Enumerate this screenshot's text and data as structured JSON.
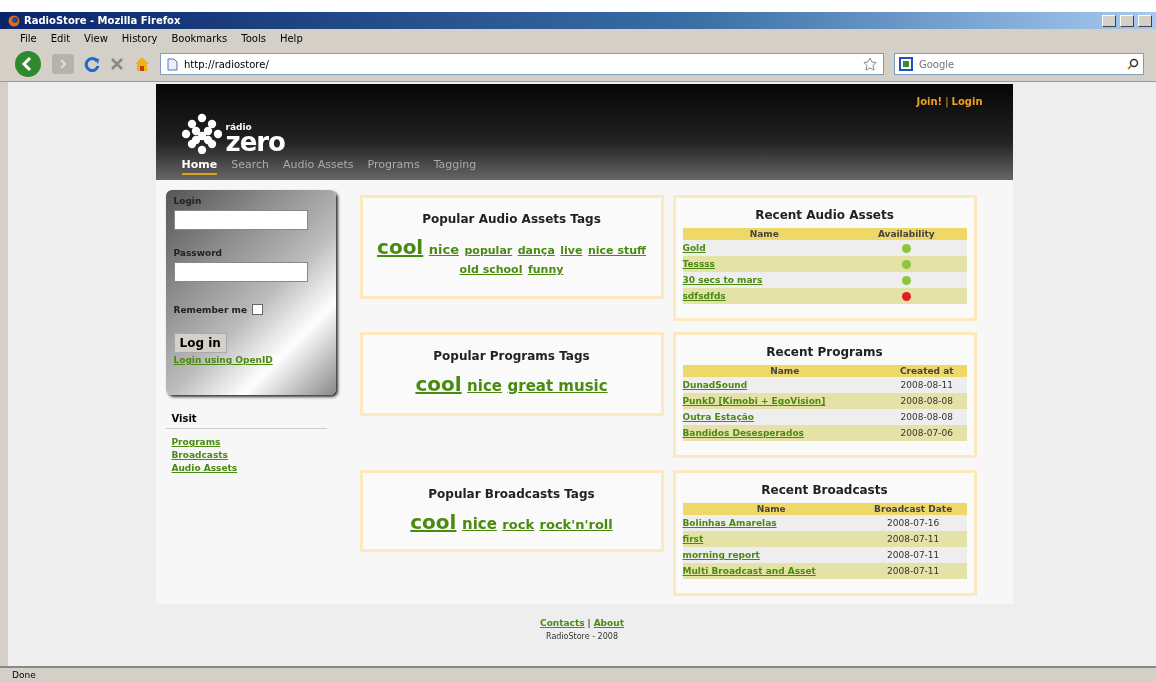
{
  "window": {
    "title": "RadioStore - Mozilla Firefox"
  },
  "menu": [
    "File",
    "Edit",
    "View",
    "History",
    "Bookmarks",
    "Tools",
    "Help"
  ],
  "address": {
    "value": "http://radiostore/"
  },
  "search": {
    "placeholder": "Google"
  },
  "site": {
    "logo_small": "rádio",
    "logo_big": "zero",
    "account_links": [
      "Join!",
      "Login"
    ],
    "account_separator": "|",
    "nav": [
      {
        "label": "Home",
        "selected": true
      },
      {
        "label": "Search",
        "selected": false
      },
      {
        "label": "Audio Assets",
        "selected": false
      },
      {
        "label": "Programs",
        "selected": false
      },
      {
        "label": "Tagging",
        "selected": false
      }
    ]
  },
  "login": {
    "login_label": "Login",
    "password_label": "Password",
    "remember_label": "Remember me",
    "remember_checked": false,
    "button": "Log in",
    "openid_link": "Login using OpenID"
  },
  "visit": {
    "title": "Visit",
    "links": [
      "Programs",
      "Broadcasts",
      "Audio Assets"
    ]
  },
  "tag_clouds": [
    {
      "title": "Popular Audio Assets Tags",
      "tags": [
        {
          "label": "cool",
          "kind": "huge"
        },
        {
          "label": "nice",
          "kind": "medium"
        },
        {
          "label": "popular",
          "kind": "small"
        },
        {
          "label": "dança",
          "kind": "small"
        },
        {
          "label": "live",
          "kind": "small"
        },
        {
          "label": "nice stuff",
          "kind": "small"
        },
        {
          "label": "old school",
          "kind": "small"
        },
        {
          "label": "funny",
          "kind": "small"
        }
      ]
    },
    {
      "title": "Popular Programs Tags",
      "tags": [
        {
          "label": "cool",
          "kind": "huge"
        },
        {
          "label": "nice",
          "kind": "large"
        },
        {
          "label": "great music",
          "kind": "large"
        }
      ]
    },
    {
      "title": "Popular Broadcasts Tags",
      "tags": [
        {
          "label": "cool",
          "kind": "huge"
        },
        {
          "label": "nice",
          "kind": "large"
        },
        {
          "label": "rock",
          "kind": "medium"
        },
        {
          "label": "rock'n'roll",
          "kind": "medium"
        }
      ]
    }
  ],
  "recent": [
    {
      "title": "Recent Audio Assets",
      "kind": "availability",
      "columns": [
        "Name",
        "Availability"
      ],
      "rows": [
        {
          "name": "Gold",
          "available": true
        },
        {
          "name": "Tessss",
          "available": true
        },
        {
          "name": "30 secs to mars",
          "available": true
        },
        {
          "name": "sdfsdfds",
          "available": false
        }
      ]
    },
    {
      "title": "Recent Programs",
      "kind": "date",
      "columns": [
        "Name",
        "Created at"
      ],
      "rows": [
        {
          "name": "DunadSound",
          "date": "2008-08-11"
        },
        {
          "name": "PunkD [Kimobi + EgoVision]",
          "date": "2008-08-08"
        },
        {
          "name": "Outra Estação",
          "date": "2008-08-08"
        },
        {
          "name": "Bandidos Desesperados",
          "date": "2008-07-06"
        }
      ]
    },
    {
      "title": "Recent Broadcasts",
      "kind": "date",
      "columns": [
        "Name",
        "Broadcast Date"
      ],
      "rows": [
        {
          "name": "Bolinhas Amarelas",
          "date": "2008-07-16"
        },
        {
          "name": "first",
          "date": "2008-07-11"
        },
        {
          "name": "morning report",
          "date": "2008-07-11"
        },
        {
          "name": "Multi Broadcast and Asset",
          "date": "2008-07-11"
        }
      ]
    }
  ],
  "footer": {
    "links": [
      "Contacts",
      "About"
    ],
    "separator": "|",
    "copyright": "RadioStore - 2008"
  },
  "status_bar": "Done"
}
